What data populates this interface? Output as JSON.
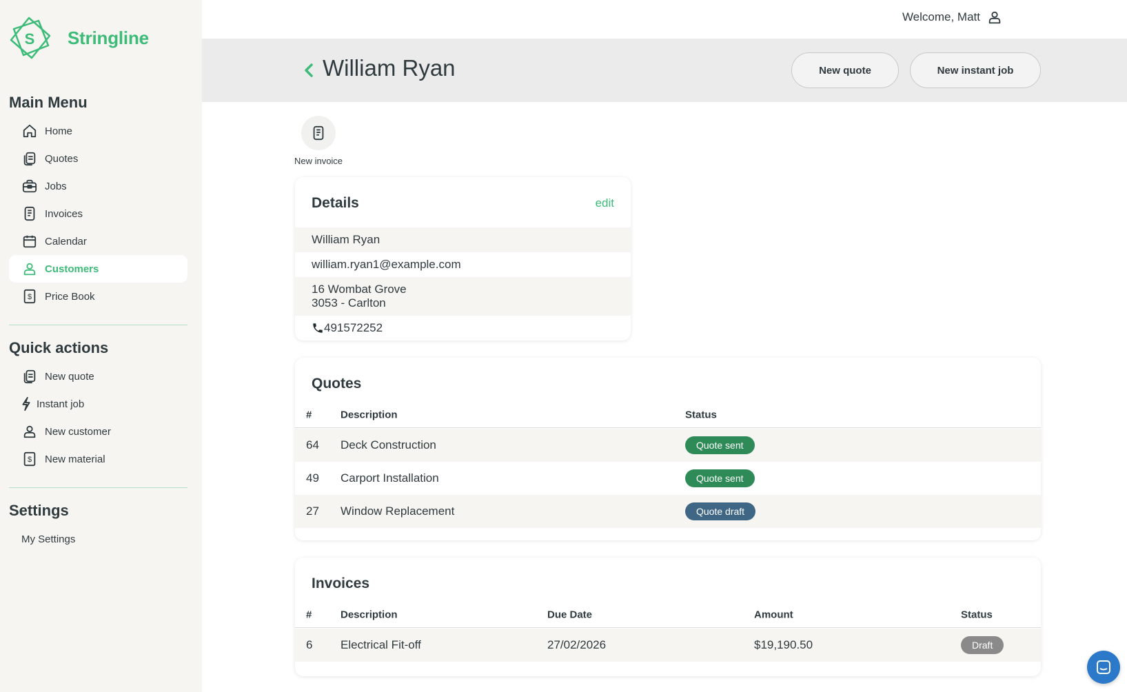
{
  "brand": {
    "name": "Stringline",
    "logo_letter": "S",
    "accent": "#3dbb78"
  },
  "topbar": {
    "welcome": "Welcome, Matt"
  },
  "sidebar": {
    "main_menu_title": "Main Menu",
    "main_menu": [
      {
        "label": "Home",
        "icon": "home-icon"
      },
      {
        "label": "Quotes",
        "icon": "quotes-icon"
      },
      {
        "label": "Jobs",
        "icon": "briefcase-icon"
      },
      {
        "label": "Invoices",
        "icon": "invoice-icon"
      },
      {
        "label": "Calendar",
        "icon": "calendar-icon"
      },
      {
        "label": "Customers",
        "icon": "user-icon",
        "active": true
      },
      {
        "label": "Price Book",
        "icon": "dollar-icon"
      }
    ],
    "quick_actions_title": "Quick actions",
    "quick_actions": [
      {
        "label": "New quote",
        "icon": "quotes-icon"
      },
      {
        "label": "Instant job",
        "icon": "lightning-icon"
      },
      {
        "label": "New customer",
        "icon": "user-icon"
      },
      {
        "label": "New material",
        "icon": "dollar-icon"
      }
    ],
    "settings_title": "Settings",
    "settings": [
      {
        "label": "My Settings"
      }
    ]
  },
  "header": {
    "title": "William Ryan",
    "new_quote": "New quote",
    "new_instant_job": "New instant job"
  },
  "quick_buttons": {
    "new_invoice": "New invoice"
  },
  "details": {
    "title": "Details",
    "edit": "edit",
    "name": "William Ryan",
    "email": "william.ryan1@example.com",
    "address_line1": "16 Wombat Grove",
    "address_line2": "3053 - Carlton",
    "phone": "491572252"
  },
  "quotes": {
    "title": "Quotes",
    "columns": {
      "num": "#",
      "description": "Description",
      "status": "Status"
    },
    "rows": [
      {
        "num": "64",
        "description": "Deck Construction",
        "status": "Quote sent",
        "status_color": "#2e8b57"
      },
      {
        "num": "49",
        "description": "Carport Installation",
        "status": "Quote sent",
        "status_color": "#2e8b57"
      },
      {
        "num": "27",
        "description": "Window Replacement",
        "status": "Quote draft",
        "status_color": "#3f6785"
      }
    ]
  },
  "invoices": {
    "title": "Invoices",
    "columns": {
      "num": "#",
      "description": "Description",
      "due_date": "Due Date",
      "amount": "Amount",
      "status": "Status"
    },
    "rows": [
      {
        "num": "6",
        "description": "Electrical Fit-off",
        "due_date": "27/02/2026",
        "amount": "$19,190.50",
        "status": "Draft",
        "status_color": "#8a8a8a"
      }
    ]
  }
}
